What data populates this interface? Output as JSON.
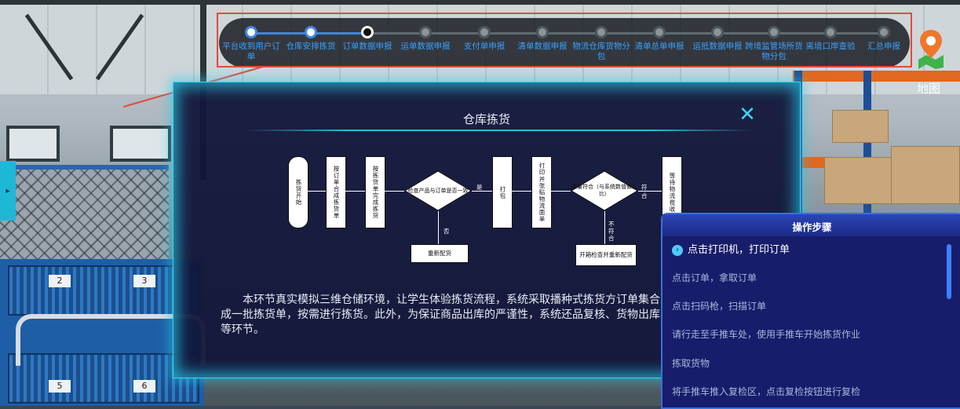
{
  "progress": {
    "steps": [
      {
        "label": "平台收到用户订单",
        "state": "done"
      },
      {
        "label": "仓库安排拣货",
        "state": "done"
      },
      {
        "label": "订单数据申报",
        "state": "current"
      },
      {
        "label": "运单数据申报",
        "state": "todo"
      },
      {
        "label": "支付单申报",
        "state": "todo"
      },
      {
        "label": "清单数据申报",
        "state": "todo"
      },
      {
        "label": "物流仓库货物分包",
        "state": "todo"
      },
      {
        "label": "清单总单申报",
        "state": "todo"
      },
      {
        "label": "运抵数据申报",
        "state": "todo"
      },
      {
        "label": "跨境监管场所货物分包",
        "state": "todo"
      },
      {
        "label": "离境口岸查验",
        "state": "todo"
      },
      {
        "label": "汇总申报",
        "state": "todo"
      }
    ]
  },
  "map": {
    "label": "地图",
    "icon": "map-pin-icon"
  },
  "modal": {
    "title": "仓库拣货",
    "close_icon": "close-icon",
    "description": "本环节真实模拟三维仓储环境，让学生体验拣货流程，系统采取播种式拣货方订单集合成一批拣货单，按需进行拣货。此外，为保证商品出库的严谨性，系统还品复核、货物出库等环节。"
  },
  "flowchart": {
    "start": "拣货开始",
    "merge_orders": "按订单合成拣货单",
    "pick": "按拣货单完成拣货",
    "check_decision": "检查产品与订单是否一致",
    "yes_label": "是",
    "no_label": "否",
    "pack": "打包",
    "print_label": "打印并张贴物流面单",
    "weight_decision": "重量符合（与系统数值做对比）",
    "match_label": "符合",
    "mismatch_label": "不符合",
    "wait_pickup": "等待物流揽收",
    "redistribute": "重新配货",
    "reopen": "开箱检查并重新配货"
  },
  "operations": {
    "title": "操作步骤",
    "items": [
      {
        "text": "点击打印机，打印订单",
        "active": true
      },
      {
        "text": "点击订单，拿取订单",
        "active": false
      },
      {
        "text": "点击扫码枪，扫描订单",
        "active": false
      },
      {
        "text": "请行走至手推车处，使用手推车开始拣货作业",
        "active": false
      },
      {
        "text": "拣取货物",
        "active": false
      },
      {
        "text": "将手推车推入复检区，点击复检按钮进行复检",
        "active": false
      }
    ]
  },
  "scene": {
    "crate_numbers": [
      "2",
      "3",
      "5",
      "6"
    ]
  },
  "colors": {
    "accent": "#3aa0ff",
    "highlight_outline": "#e24b3b",
    "modal_glow": "#33d6f0",
    "panel_bg": "#171d6b"
  }
}
